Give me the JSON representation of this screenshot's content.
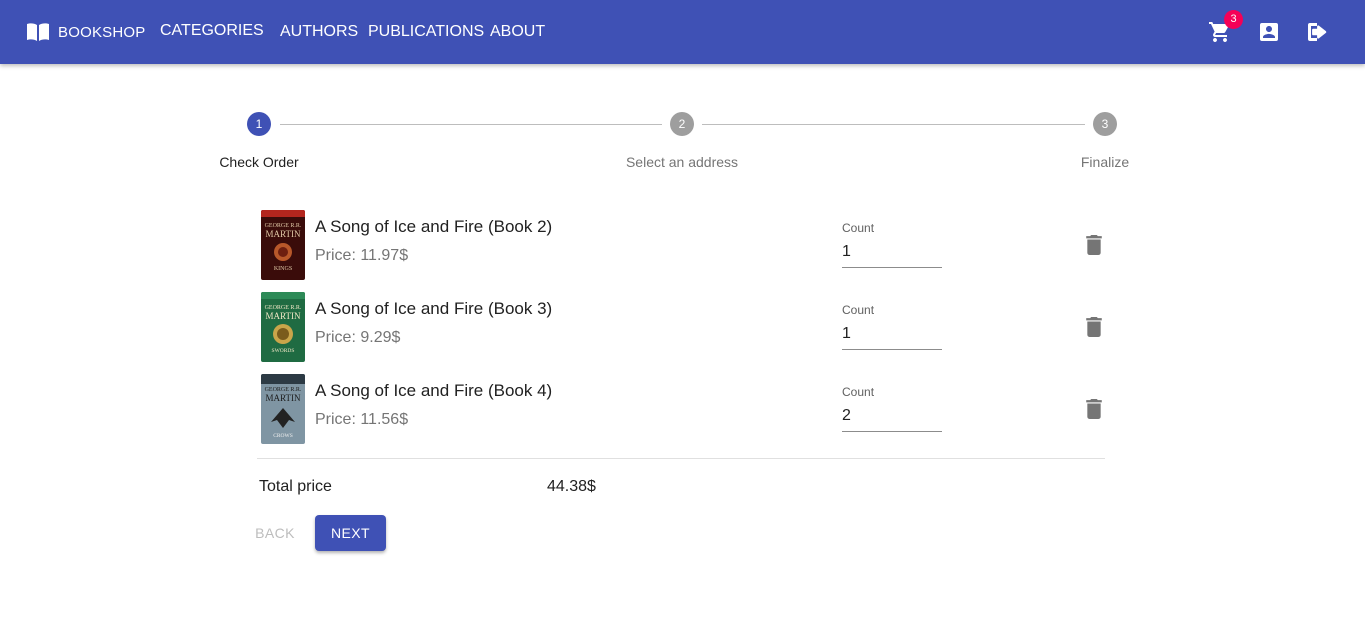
{
  "header": {
    "brand": "BOOKSHOP",
    "nav": [
      "CATEGORIES",
      "AUTHORS",
      "PUBLICATIONS",
      "ABOUT"
    ],
    "cart_badge": "3",
    "icons": [
      "book-icon",
      "cart-icon",
      "account-box-icon",
      "logout-icon"
    ],
    "color": "#3f51b5",
    "badge_color": "#f50057"
  },
  "stepper": {
    "steps": [
      {
        "number": "1",
        "label": "Check Order",
        "active": true
      },
      {
        "number": "2",
        "label": "Select an address",
        "active": false
      },
      {
        "number": "3",
        "label": "Finalize",
        "active": false
      }
    ],
    "active_color": "#3f51b5",
    "inactive_color": "#9e9e9e"
  },
  "cart": {
    "count_label": "Count",
    "items": [
      {
        "title": "A Song of Ice and Fire (Book 2)",
        "price": "Price: 11.97$",
        "count": "1",
        "cover_color": "#8b1a14"
      },
      {
        "title": "A Song of Ice and Fire (Book 3)",
        "price": "Price: 9.29$",
        "count": "1",
        "cover_color": "#2e7d4f"
      },
      {
        "title": "A Song of Ice and Fire (Book 4)",
        "price": "Price: 11.56$",
        "count": "2",
        "cover_color": "#5f7786"
      }
    ],
    "total_label": "Total price",
    "total_value": "44.38$"
  },
  "actions": {
    "back": "BACK",
    "next": "NEXT"
  }
}
